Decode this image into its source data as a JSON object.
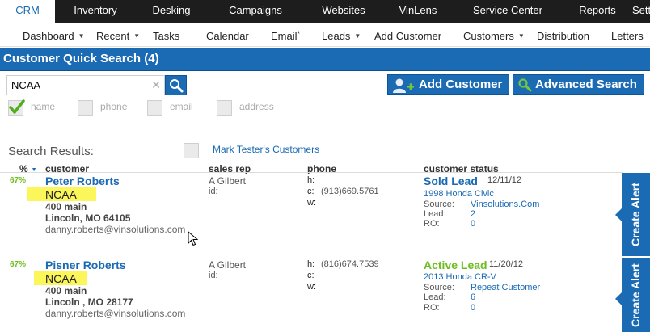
{
  "nav": {
    "tabs": [
      {
        "label": "CRM",
        "active": true
      },
      {
        "label": "Inventory"
      },
      {
        "label": "Desking"
      },
      {
        "label": "Campaigns"
      },
      {
        "label": "Websites"
      },
      {
        "label": "VinLens"
      },
      {
        "label": "Service Center"
      },
      {
        "label": "Reports"
      },
      {
        "label": "Setti"
      }
    ]
  },
  "subnav": {
    "items": [
      {
        "label": "Dashboard",
        "dropdown": true
      },
      {
        "label": "Recent",
        "dropdown": true
      },
      {
        "label": "Tasks"
      },
      {
        "label": "Calendar"
      },
      {
        "label": "Email",
        "sup": "*"
      },
      {
        "label": "Leads",
        "dropdown": true
      },
      {
        "label": "Add Customer"
      },
      {
        "label": "Customers",
        "dropdown": true
      },
      {
        "label": "Distribution"
      },
      {
        "label": "Letters"
      }
    ]
  },
  "page": {
    "title": "Customer Quick Search (4)"
  },
  "search": {
    "value": "NCAA",
    "clear_glyph": "✕",
    "options": [
      {
        "label": "name",
        "checked": true
      },
      {
        "label": "phone",
        "checked": false
      },
      {
        "label": "email",
        "checked": false
      },
      {
        "label": "address",
        "checked": false
      }
    ]
  },
  "buttons": {
    "add_customer": "Add Customer",
    "advanced_search": "Advanced Search"
  },
  "results": {
    "label": "Search Results:",
    "my_customers_link": "Mark Tester's Customers",
    "columns": {
      "pct": "%",
      "customer": "customer",
      "sales_rep": "sales rep",
      "phone": "phone",
      "status": "customer status"
    },
    "rows": [
      {
        "pct": "67%",
        "name": "Peter Roberts",
        "tag": "NCAA",
        "street": "400 main",
        "city": "Lincoln, MO 64105",
        "email": "danny.roberts@vinsolutions.com",
        "rep": "A Gilbert",
        "rep_id_label": "id:",
        "phone_h_label": "h:",
        "phone_h": "",
        "phone_c_label": "c:",
        "phone_c": "(913)669.5761",
        "phone_w_label": "w:",
        "phone_w": "",
        "status": "Sold Lead",
        "status_color": "#1a6ab4",
        "date": "12/11/12",
        "vehicle": "1998 Honda Civic",
        "source_label": "Source:",
        "source": "Vinsolutions.Com",
        "lead_label": "Lead:",
        "lead": "2",
        "ro_label": "RO:",
        "ro": "0",
        "alert_label": "Create Alert"
      },
      {
        "pct": "67%",
        "name": "Pisner Roberts",
        "tag": "NCAA",
        "street": "400 main",
        "city": "Lincoln , MO 28177",
        "email": "danny.roberts@vinsolutions.com",
        "rep": "A Gilbert",
        "rep_id_label": "id:",
        "phone_h_label": "h:",
        "phone_h": "(816)674.7539",
        "phone_c_label": "c:",
        "phone_c": "",
        "phone_w_label": "w:",
        "phone_w": "",
        "status": "Active Lead",
        "status_color": "#6cbe1f",
        "date": "11/20/12",
        "vehicle": "2013 Honda CR-V",
        "source_label": "Source:",
        "source": "Repeat Customer",
        "lead_label": "Lead:",
        "lead": "6",
        "ro_label": "RO:",
        "ro": "0",
        "alert_label": "Create Alert"
      }
    ]
  },
  "colors": {
    "brand_blue": "#1a6ab4",
    "nav_black": "#1d1d1d",
    "highlight": "#fbf65a",
    "active_green": "#6cbe1f"
  }
}
